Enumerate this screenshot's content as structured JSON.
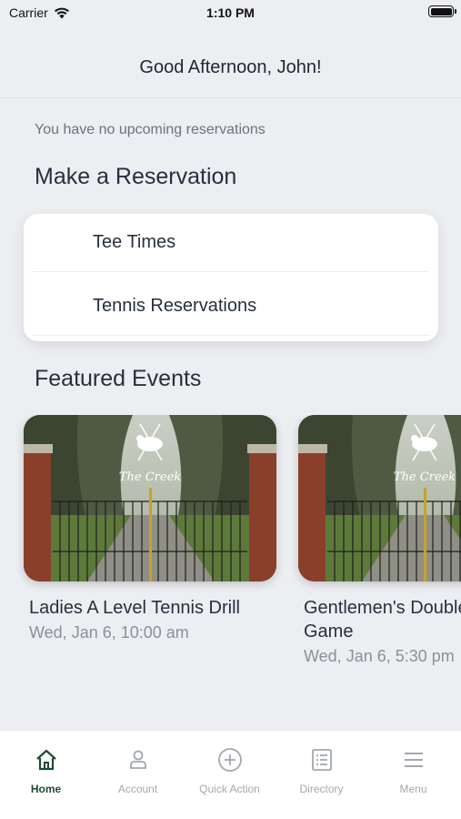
{
  "status_bar": {
    "carrier": "Carrier",
    "time": "1:10 PM"
  },
  "header": {
    "greeting": "Good Afternoon, John!"
  },
  "reservations": {
    "empty_message": "You have no upcoming reservations"
  },
  "make_reservation": {
    "title": "Make a Reservation",
    "items": [
      {
        "label": "Tee Times"
      },
      {
        "label": "Tennis Reservations"
      }
    ]
  },
  "featured_events": {
    "title": "Featured Events",
    "events": [
      {
        "title": "Ladies A Level Tennis Drill",
        "date": "Wed, Jan 6, 10:00 am",
        "image_caption": "The Creek"
      },
      {
        "title": "Gentlemen's Doubles Game",
        "date": "Wed, Jan 6, 5:30 pm",
        "image_caption": "The Creek"
      }
    ]
  },
  "tab_bar": {
    "tabs": [
      {
        "label": "Home",
        "icon": "home-icon",
        "active": true
      },
      {
        "label": "Account",
        "icon": "person-icon",
        "active": false
      },
      {
        "label": "Quick Action",
        "icon": "plus-circle-icon",
        "active": false
      },
      {
        "label": "Directory",
        "icon": "list-icon",
        "active": false
      },
      {
        "label": "Menu",
        "icon": "hamburger-icon",
        "active": false
      }
    ]
  },
  "colors": {
    "accent": "#1f4a33",
    "background": "#eceef1",
    "inactive": "#a2a8b0"
  }
}
